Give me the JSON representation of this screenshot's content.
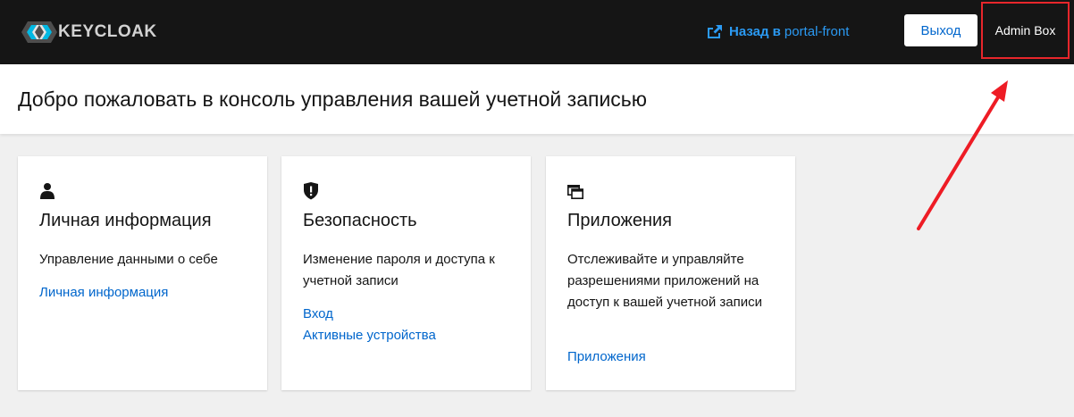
{
  "topbar": {
    "logo_text": "KEYCLOAK",
    "logo_icon": "keycloak-logo",
    "back_link": {
      "icon": "external-link-icon",
      "label_bold": "Назад в",
      "app_name": "portal-front"
    },
    "logout_label": "Выход",
    "user_name": "Admin Box"
  },
  "header": {
    "title": "Добро пожаловать в консоль управления вашей учетной записью"
  },
  "cards": [
    {
      "icon": "user-icon",
      "title": "Личная информация",
      "description": "Управление данными о себе",
      "links": [
        "Личная информация"
      ]
    },
    {
      "icon": "shield-icon",
      "title": "Безопасность",
      "description": "Изменение пароля и доступа к учетной записи",
      "links": [
        "Вход",
        "Активные устройства"
      ]
    },
    {
      "icon": "applications-icon",
      "title": "Приложения",
      "description": "Отслеживайте и управляйте разрешениями приложений на доступ к вашей учетной записи",
      "links": [
        "Приложения"
      ]
    }
  ],
  "colors": {
    "topbar_bg": "#151515",
    "link": "#0066cc",
    "back_link": "#2b9af3",
    "highlight": "#e8262b",
    "page_bg": "#f0f0f0"
  }
}
